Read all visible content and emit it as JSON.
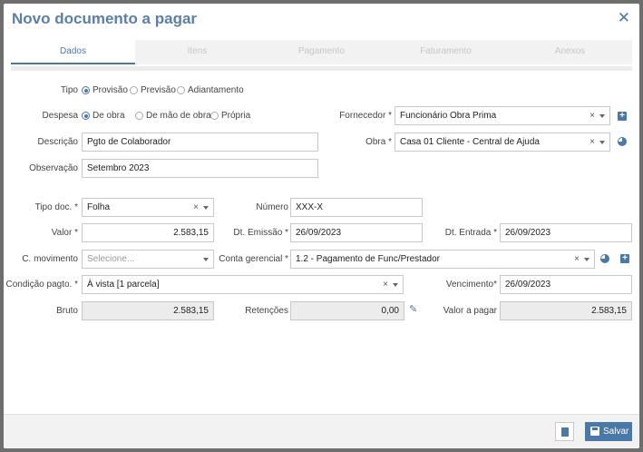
{
  "header": {
    "title": "Novo documento a pagar",
    "close_icon": "close-icon"
  },
  "tabs": [
    {
      "label": "Dados",
      "active": true
    },
    {
      "label": "Itens",
      "active": false
    },
    {
      "label": "Pagamento",
      "active": false
    },
    {
      "label": "Faturamento",
      "active": false
    },
    {
      "label": "Anexos",
      "active": false
    }
  ],
  "form": {
    "tipo": {
      "label": "Tipo",
      "options": [
        "Provisão",
        "Previsão",
        "Adiantamento"
      ],
      "selected": "Provisão"
    },
    "despesa": {
      "label": "Despesa",
      "options": [
        "De obra",
        "De mão de obra",
        "Própria"
      ],
      "selected": "De obra"
    },
    "descricao": {
      "label": "Descrição",
      "value": "Pgto de Colaborador"
    },
    "observacao": {
      "label": "Observação",
      "value": "Setembro 2023"
    },
    "fornecedor": {
      "label": "Fornecedor *",
      "value": "Funcionário Obra Prima"
    },
    "obra": {
      "label": "Obra *",
      "value": "Casa 01 Cliente - Central de Ajuda"
    },
    "tipo_doc": {
      "label": "Tipo doc. *",
      "value": "Folha"
    },
    "numero": {
      "label": "Número",
      "value": "XXX-X"
    },
    "valor": {
      "label": "Valor *",
      "value": "2.583,15"
    },
    "dt_emissao": {
      "label": "Dt. Emissão *",
      "value": "26/09/2023"
    },
    "dt_entrada": {
      "label": "Dt. Entrada *",
      "value": "26/09/2023"
    },
    "c_movimento": {
      "label": "C. movimento",
      "placeholder": "Selecione..."
    },
    "conta_gerencial": {
      "label": "Conta gerencial *",
      "value": "1.2 - Pagamento de Func/Prestador"
    },
    "condicao_pagto": {
      "label": "Condição pagto. *",
      "value": "À vista [1 parcela]"
    },
    "vencimento": {
      "label": "Vencimento*",
      "value": "26/09/2023"
    },
    "bruto": {
      "label": "Bruto",
      "value": "2.583,15"
    },
    "retencoes": {
      "label": "Retenções",
      "value": "0,00"
    },
    "valor_pagar": {
      "label": "Valor a pagar",
      "value": "2.583,15"
    }
  },
  "footer": {
    "save_label": "Salvar"
  },
  "colors": {
    "accent": "#4a78a8",
    "title": "#5b7fa8"
  }
}
